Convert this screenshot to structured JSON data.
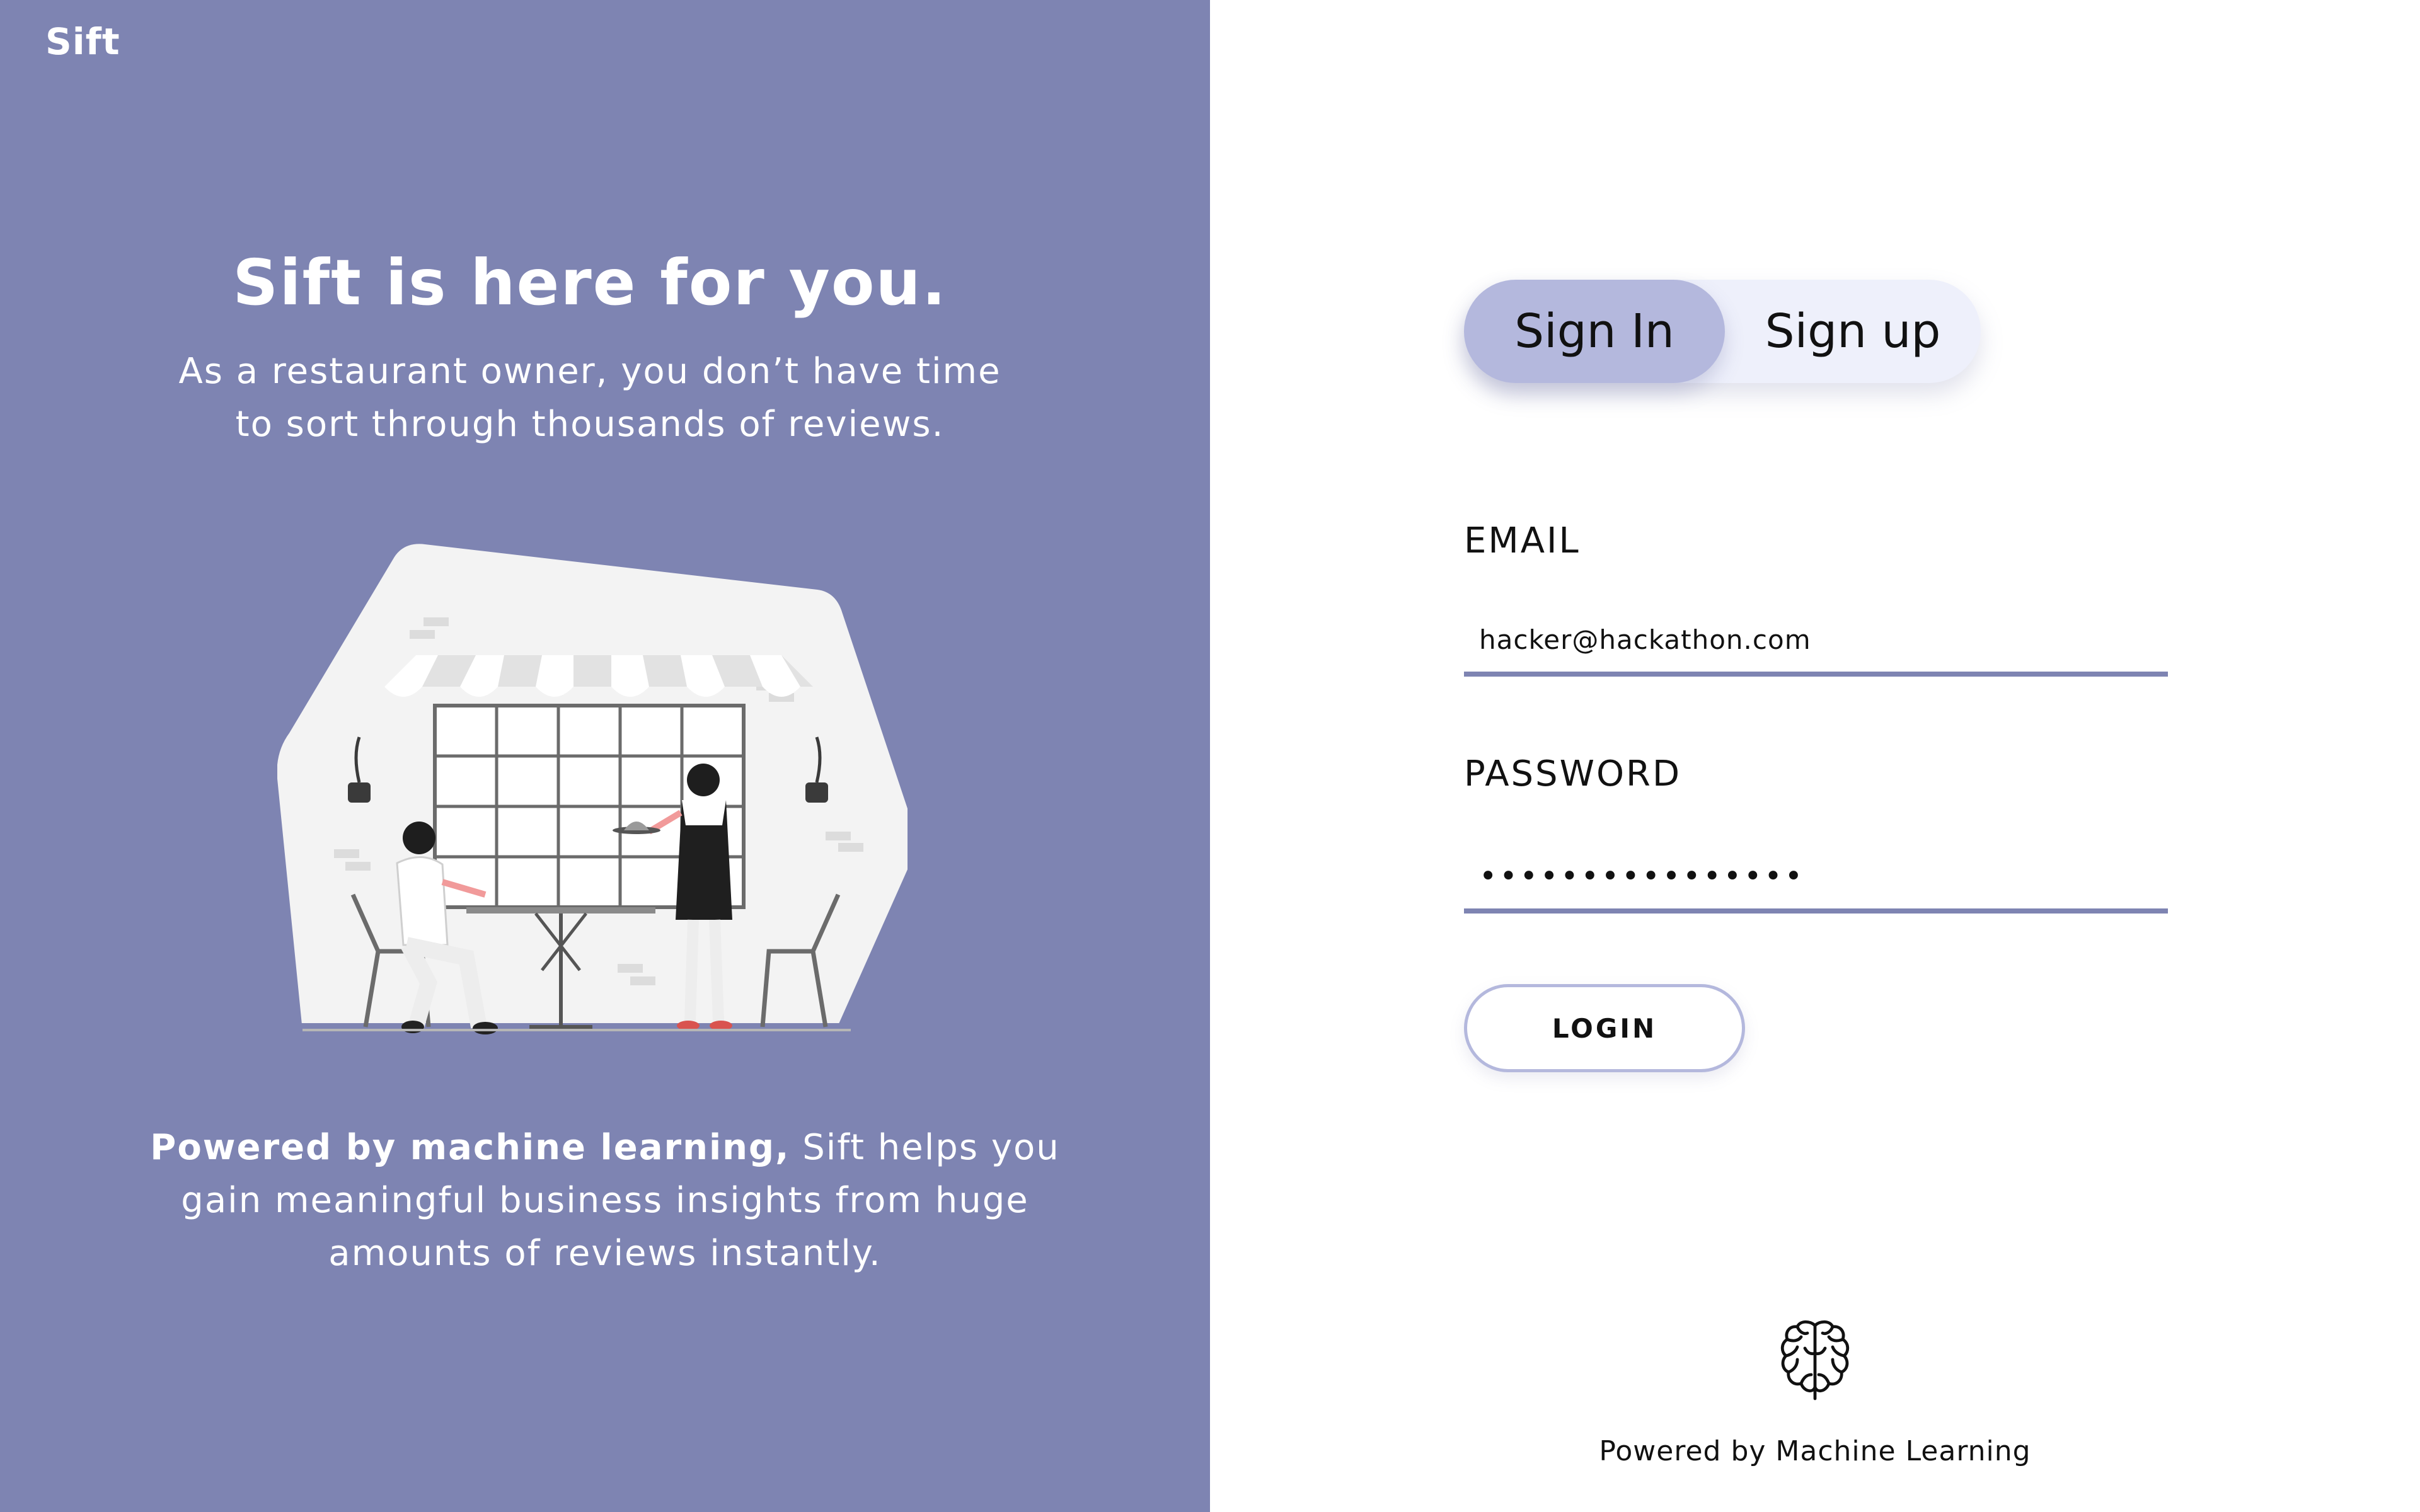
{
  "brand": {
    "name": "Sift"
  },
  "hero": {
    "title": "Sift is here for you.",
    "subtitle": "As a restaurant owner, you don’t have time to sort through thousands of reviews."
  },
  "illustration": {
    "icon": "restaurant-cafe-illustration"
  },
  "footer": {
    "bold": "Powered by machine learning,",
    "rest": " Sift helps you gain meaningful business insights from huge amounts of reviews instantly."
  },
  "auth_tabs": {
    "sign_in": "Sign In",
    "sign_up": "Sign up",
    "active": "sign_in"
  },
  "form": {
    "email_label": "EMAIL",
    "email_value": "hacker@hackathon.com",
    "password_label": "PASSWORD",
    "password_value": "••••••••••••••••",
    "login_label": "LOGIN"
  },
  "powered_by": {
    "text": "Powered by Machine Learning",
    "icon": "brain-icon"
  },
  "colors": {
    "panel": "#7e84b2",
    "tab_active": "#b4b8dd",
    "tab_bg": "#eef0fb",
    "underline": "#7e84b2"
  }
}
